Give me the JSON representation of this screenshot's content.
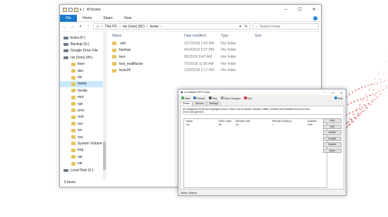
{
  "explorer": {
    "window_title": "W:\\home",
    "ribbon_tabs": [
      "File",
      "Home",
      "Share",
      "View"
    ],
    "address_path": [
      "This PC",
      "nix (\\\\nix) (W:)",
      "home"
    ],
    "search_placeholder": "Search home",
    "nav_items": [
      {
        "label": "Extra (F:)",
        "kind": "drive",
        "level": 0
      },
      {
        "label": "Backup (G:)",
        "kind": "drive",
        "level": 0
      },
      {
        "label": "Google Drive File",
        "kind": "drive",
        "level": 0
      },
      {
        "label": "nix (\\\\nix) (W:)",
        "kind": "drive",
        "level": 0
      },
      {
        "label": "boot",
        "kind": "folder",
        "level": 1
      },
      {
        "label": "dev",
        "kind": "folder",
        "level": 1
      },
      {
        "label": "etc",
        "kind": "folder",
        "level": 1
      },
      {
        "label": "home",
        "kind": "folder",
        "level": 1,
        "selected": true
      },
      {
        "label": "media",
        "kind": "folder",
        "level": 1
      },
      {
        "label": "mnt",
        "kind": "folder",
        "level": 1
      },
      {
        "label": "opt",
        "kind": "folder",
        "level": 1
      },
      {
        "label": "proc",
        "kind": "folder",
        "level": 1
      },
      {
        "label": "root",
        "kind": "folder",
        "level": 1
      },
      {
        "label": "run",
        "kind": "folder",
        "level": 1
      },
      {
        "label": "srv",
        "kind": "folder",
        "level": 1
      },
      {
        "label": "sys",
        "kind": "folder",
        "level": 1
      },
      {
        "label": "System Volume",
        "kind": "folder",
        "level": 1
      },
      {
        "label": "tmp",
        "kind": "folder",
        "level": 1
      },
      {
        "label": "usr",
        "kind": "folder",
        "level": 1
      },
      {
        "label": "var",
        "kind": "folder",
        "level": 1
      },
      {
        "label": "Local Disk (X:)",
        "kind": "drive",
        "level": 0
      }
    ],
    "columns": [
      "Name",
      "Date modified",
      "Type",
      "Size"
    ],
    "files": [
      {
        "name": ".ssh",
        "date": "1/17/2018 2:43 PM",
        "type": "File folder"
      },
      {
        "name": "backup",
        "date": "4/10/2019 5:37 PM",
        "type": "File folder"
      },
      {
        "name": "test",
        "date": "8/5/2019 8:47 AM",
        "type": "File folder"
      },
      {
        "name": "test_multifactor",
        "date": "7/3/2018 11:50 AM",
        "type": "File folder"
      },
      {
        "name": "testv20",
        "date": "1/26/2018 5:17 PM",
        "type": "File folder"
      }
    ],
    "status": "5 items"
  },
  "ssh": {
    "window_title": "/n software SFTP Drive",
    "toolbar": [
      "Start",
      "Restart",
      "Stop",
      "Save Changes",
      "Exit",
      "Help"
    ],
    "tabs": [
      "Drives",
      "Service",
      "Settings"
    ],
    "info": "All configured drives are displayed below. Drives can be added, deleted, edited, enabled and disabled from this view.",
    "section": "Drive Management",
    "table_headers": [
      "Name",
      "Drive Letter",
      "Remote Host",
      "Remote Directory",
      "Enabled"
    ],
    "rows": [
      {
        "name": "nix",
        "letter": "W:",
        "host": "nix",
        "dir": "/",
        "enabled": "True"
      }
    ],
    "side_buttons": [
      "New",
      "Edit",
      "Delete",
      "Enable",
      "Disable",
      "Open"
    ],
    "status": "Status: Started"
  },
  "colors": {
    "accent": "#1979ca",
    "folder": "#e8c25a",
    "selected": "#cce8ff",
    "decor": "#e05050"
  }
}
